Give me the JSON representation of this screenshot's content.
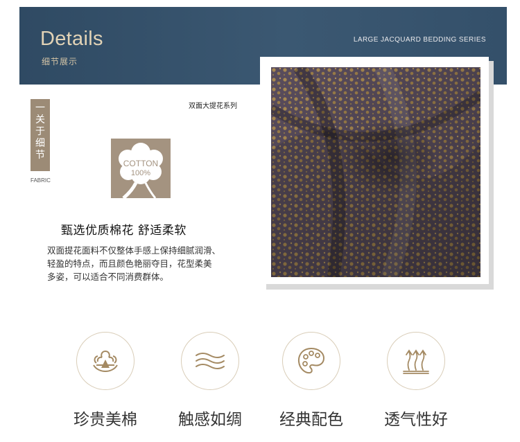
{
  "banner": {
    "title": "Details",
    "subtitle": "细节展示",
    "series_en": "LARGE JACQUARD BEDDING SERIES"
  },
  "side_tag": {
    "chars": [
      "一",
      "关",
      "于",
      "细",
      "节"
    ],
    "caption": "FABRIC"
  },
  "series_cn": "双面大提花系列",
  "cotton_badge": {
    "line1": "COTTON",
    "line2": "100%"
  },
  "headline": "甄选优质棉花  舒适柔软",
  "description": [
    "双面提花面料不仅整体手感上保持细腻润滑、",
    "轻盈的特点，而且颜色艳丽夺目，花型柔美",
    "多姿，可以适合不同消费群体。"
  ],
  "colors": {
    "banner": "#34506a",
    "accent_tan": "#9c8b76",
    "icon_gold": "#a48a63",
    "fabric_base": "#5e5162",
    "fabric_flower": "#b59356"
  },
  "features": [
    {
      "icon": "cotton-flower-icon",
      "label": "珍贵美棉"
    },
    {
      "icon": "silk-waves-icon",
      "label": "触感如绸"
    },
    {
      "icon": "palette-icon",
      "label": "经典配色"
    },
    {
      "icon": "breathable-arrows-icon",
      "label": "透气性好"
    }
  ]
}
